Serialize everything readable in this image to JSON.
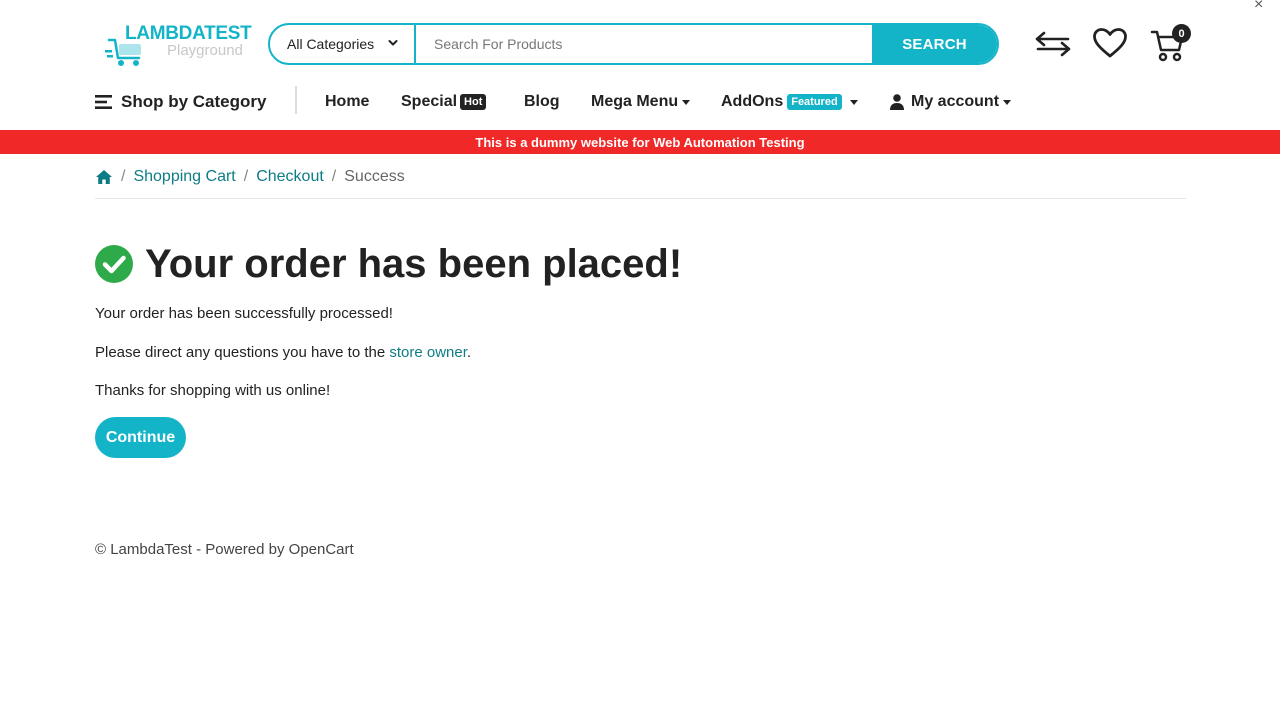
{
  "header": {
    "logo_text": "LAMBDATEST",
    "logo_sub": "Playground",
    "search": {
      "category": "All Categories",
      "placeholder": "Search For Products",
      "button": "SEARCH"
    },
    "cart_count": "0",
    "close_symbol": "×"
  },
  "nav": {
    "shop_by_category": "Shop by Category",
    "home": "Home",
    "special": "Special",
    "special_badge": "Hot",
    "blog": "Blog",
    "mega_menu": "Mega Menu",
    "addons": "AddOns",
    "addons_badge": "Featured",
    "my_account": "My account"
  },
  "banner": "This is a dummy website for Web Automation Testing",
  "breadcrumb": {
    "items": [
      "Shopping Cart",
      "Checkout"
    ],
    "active": "Success",
    "separator": "/"
  },
  "main": {
    "heading": "Your order has been placed!",
    "line1": "Your order has been successfully processed!",
    "line2_prefix": "Please direct any questions you have to the ",
    "line2_link": "store owner",
    "line2_suffix": ".",
    "line3": "Thanks for shopping with us online!",
    "continue": "Continue"
  },
  "footer": "© LambdaTest - Powered by OpenCart",
  "colors": {
    "accent": "#14b4c8",
    "link": "#0e7c86",
    "banner": "#f02828",
    "success": "#2eaa4a"
  }
}
